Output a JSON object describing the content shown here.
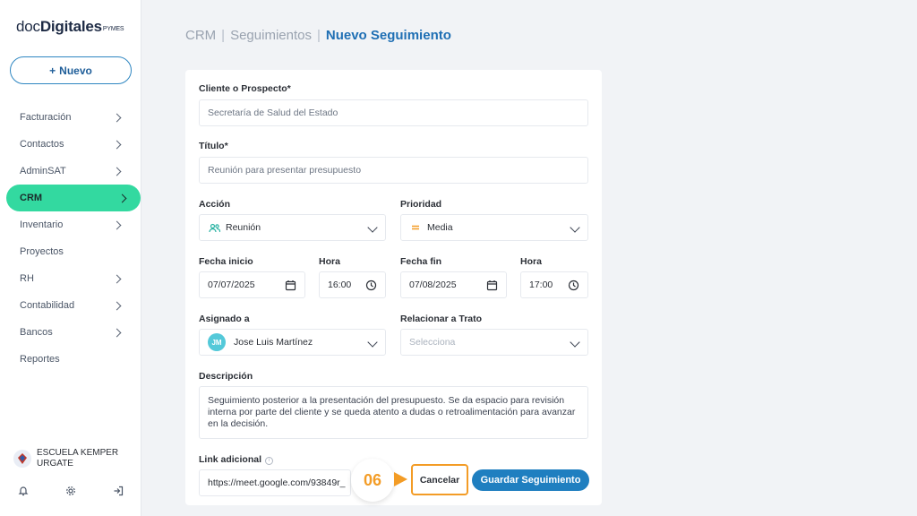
{
  "brand": {
    "name_light": "doc",
    "name_bold": "Digitales",
    "suffix": "PYMES"
  },
  "sidebar": {
    "new_button": {
      "icon": "+",
      "label": "Nuevo"
    },
    "items": [
      {
        "label": "Facturación",
        "has_chevron": true
      },
      {
        "label": "Contactos",
        "has_chevron": true
      },
      {
        "label": "AdminSAT",
        "has_chevron": true
      },
      {
        "label": "CRM",
        "has_chevron": true,
        "active": true
      },
      {
        "label": "Inventario",
        "has_chevron": true
      },
      {
        "label": "Proyectos",
        "has_chevron": false
      },
      {
        "label": "RH",
        "has_chevron": true
      },
      {
        "label": "Contabilidad",
        "has_chevron": true
      },
      {
        "label": "Bancos",
        "has_chevron": true
      },
      {
        "label": "Reportes",
        "has_chevron": false
      }
    ],
    "org_name": "ESCUELA KEMPER URGATE",
    "bottom_icons": [
      "bell-icon",
      "gear-icon",
      "logout-icon"
    ],
    "accent_color": "#33d9a0"
  },
  "breadcrumb": {
    "part1": "CRM",
    "sep": "|",
    "part2": "Seguimientos",
    "current": "Nuevo Seguimiento"
  },
  "form": {
    "client_label": "Cliente o Prospecto*",
    "client_value": "Secretaría de Salud del Estado",
    "title_label": "Título*",
    "title_value": "Reunión para presentar presupuesto",
    "action_label": "Acción",
    "action_value": "Reunión",
    "priority_label": "Prioridad",
    "priority_value": "Media",
    "start_date_label": "Fecha inicio",
    "start_date_value": "07/07/2025",
    "start_time_label": "Hora",
    "start_time_value": "16:00",
    "end_date_label": "Fecha fin",
    "end_date_value": "07/08/2025",
    "end_time_label": "Hora",
    "end_time_value": "17:00",
    "assigned_label": "Asignado a",
    "assigned_initials": "JM",
    "assigned_value": "Jose Luis Martínez",
    "deal_label": "Relacionar a Trato",
    "deal_placeholder": "Selecciona",
    "description_label": "Descripción",
    "description_value": "Seguimiento posterior a la presentación del presupuesto. Se da espacio para revisión interna por parte del cliente y se queda atento a dudas o retroalimentación para avanzar en la decisión.",
    "link_label": "Link adicional",
    "link_value": "https://meet.google.com/93849r_"
  },
  "actions": {
    "step_number": "06",
    "cancel_label": "Cancelar",
    "save_label": "Guardar Seguimiento"
  },
  "colors": {
    "primary": "#1f7fc0",
    "highlight": "#f39c26"
  }
}
